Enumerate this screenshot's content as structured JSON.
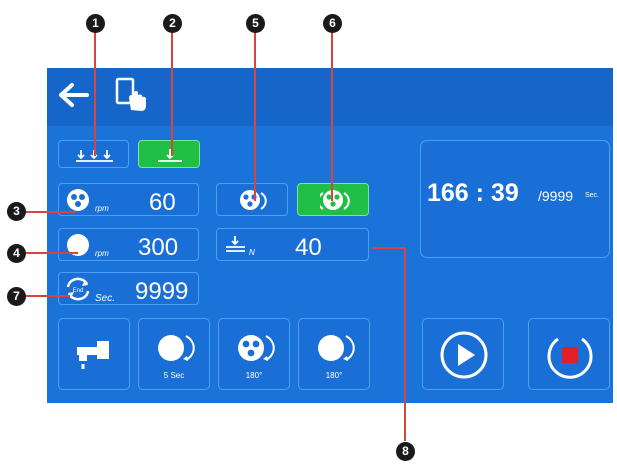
{
  "callouts": {
    "c1": "1",
    "c2": "2",
    "c3": "3",
    "c4": "4",
    "c5": "5",
    "c6": "6",
    "c7": "7",
    "c8": "8"
  },
  "icons": {
    "back": "back-arrow-icon",
    "touch": "touch-screen-icon"
  },
  "left_controls": {
    "speed1": {
      "value": "60",
      "unit": "rpm"
    },
    "speed2": {
      "value": "300",
      "unit": "rpm"
    },
    "time": {
      "value": "9999",
      "unit": "Sec.",
      "badge": "End"
    }
  },
  "force": {
    "value": "40",
    "unit": "N"
  },
  "timer": {
    "main": "166 : 39",
    "total": "/9999",
    "unit": "Sec."
  },
  "bottom_buttons": {
    "rotate_time": "5 Sec",
    "rotate_multi": "180°",
    "rotate_single": "180°"
  },
  "colors": {
    "panel": "#1a73d9",
    "topbar": "#1666c9",
    "green": "#1fbf45",
    "stop": "#e3202a"
  }
}
